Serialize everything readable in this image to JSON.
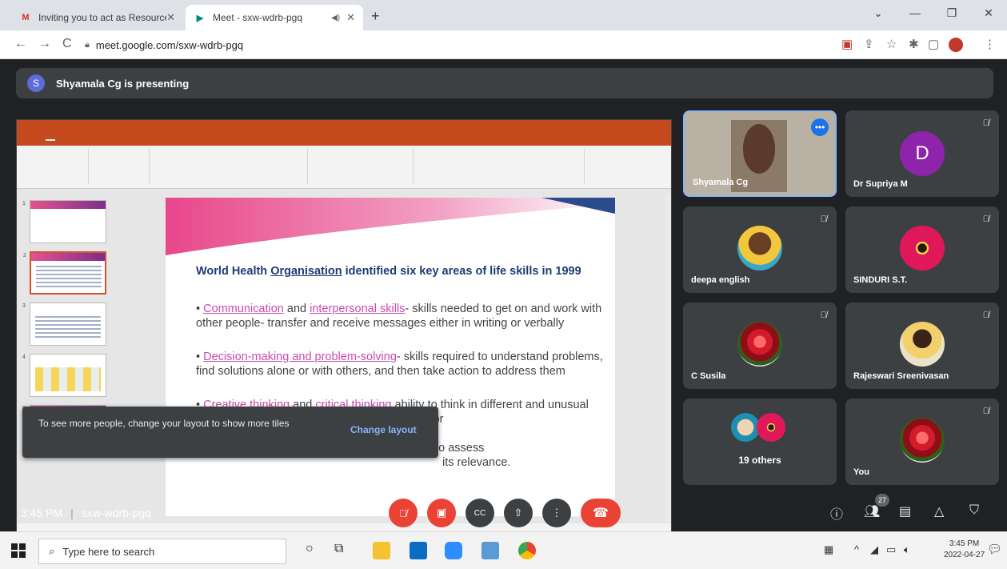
{
  "browser": {
    "tabs": [
      {
        "label": "Inviting you to act as Resource P",
        "icon": "gmail-icon",
        "active": false
      },
      {
        "label": "Meet - sxw-wdrb-pgq",
        "icon": "meet-icon",
        "active": true
      }
    ],
    "url": "meet.google.com/sxw-wdrb-pgq"
  },
  "meet": {
    "presenting_initial": "S",
    "presenting_text": "Shyamala Cg is presenting",
    "toast": {
      "message": "To see more people, change your layout to show more tiles",
      "action": "Change layout"
    },
    "participants": [
      {
        "name": "Shyamala Cg",
        "muted": false
      },
      {
        "name": "Dr Supriya M",
        "initial": "D",
        "muted": true,
        "avatar_color": "#8e24aa"
      },
      {
        "name": "deepa english",
        "muted": true
      },
      {
        "name": "SINDURI S.T.",
        "muted": true
      },
      {
        "name": "C Susila",
        "muted": true
      },
      {
        "name": "Rajeswari Sreenivasan",
        "muted": true
      },
      {
        "name": "19 others"
      },
      {
        "name": "You",
        "muted": true
      }
    ],
    "time": "3:45 PM",
    "meeting_code": "sxw-wdrb-pgq",
    "participant_count": "27"
  },
  "slide": {
    "heading_prefix": "World Health ",
    "heading_org": "Organisation",
    "heading_suffix": " identified six key areas of life skills in 1999",
    "bullets": [
      {
        "hl1": "Communication",
        "mid": " and ",
        "hl2": "interpersonal skills",
        "rest": "- skills needed to get on and work with other people- transfer and receive messages either in writing or verbally"
      },
      {
        "hl1": "Decision-making and problem-solving",
        "rest": "- skills required to understand problems, find solutions alone or with others, and then take action to address them"
      },
      {
        "hl1": "Creative thinking",
        "mid": " and ",
        "hl2": "critical thinking",
        "rest": " ability to think in different and unusual ways about problems, and find new solutions, or",
        "line4": "ability to assess",
        "line5": "its relevance."
      }
    ]
  },
  "taskbar": {
    "search_placeholder": "Type here to search",
    "clock_time": "3:45 PM",
    "clock_date": "2022-04-27"
  }
}
